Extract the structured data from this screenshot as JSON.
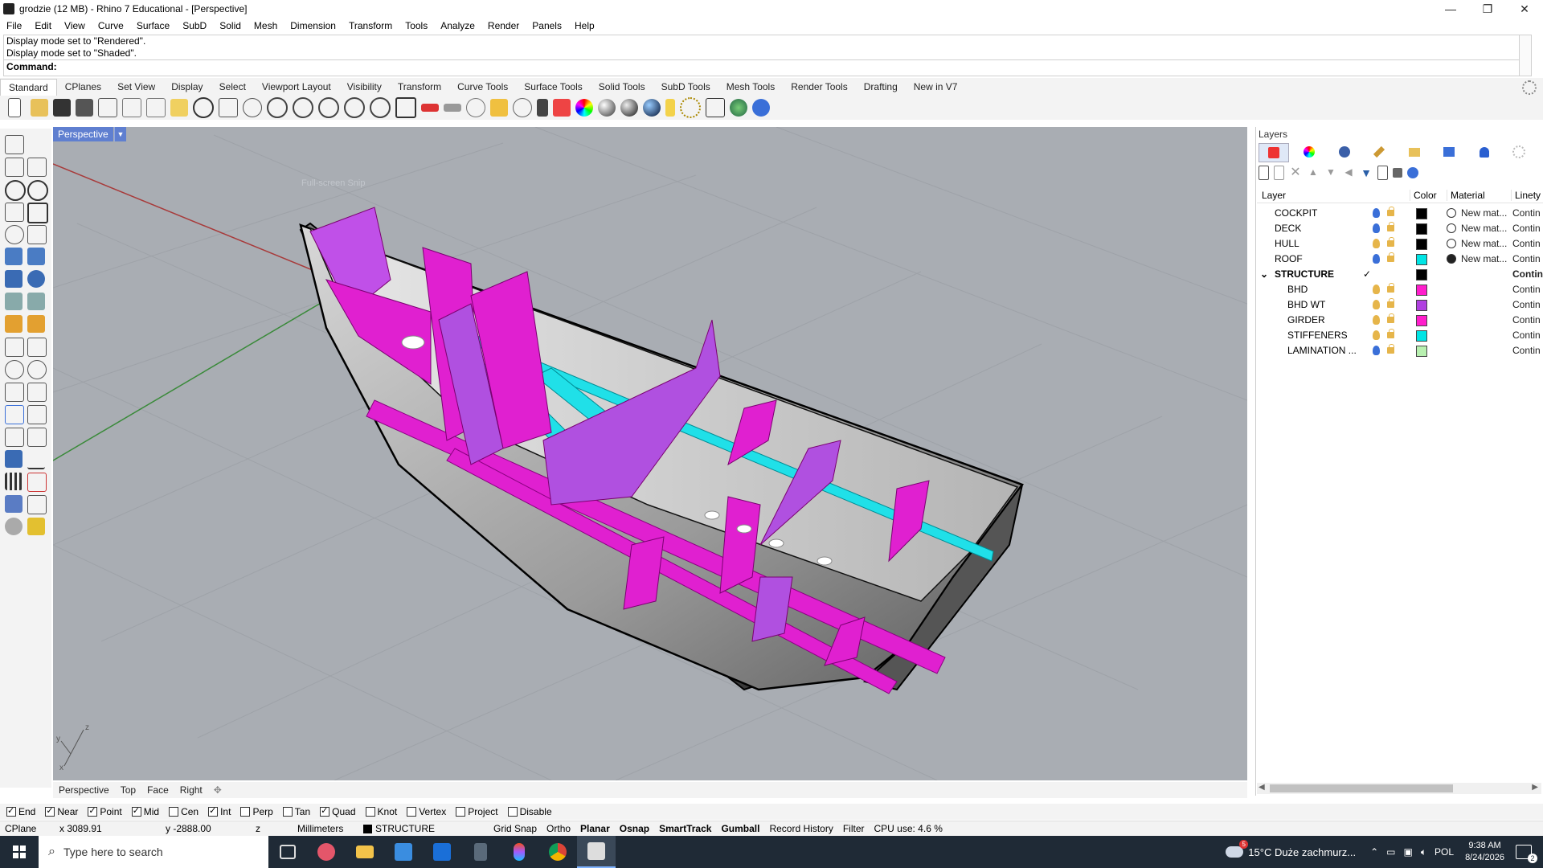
{
  "window": {
    "title": "grodzie (12 MB) - Rhino 7 Educational - [Perspective]",
    "minimize_glyph": "—",
    "restore_glyph": "❐",
    "close_glyph": "✕"
  },
  "menu": [
    "File",
    "Edit",
    "View",
    "Curve",
    "Surface",
    "SubD",
    "Solid",
    "Mesh",
    "Dimension",
    "Transform",
    "Tools",
    "Analyze",
    "Render",
    "Panels",
    "Help"
  ],
  "command_history": [
    "Display mode set to \"Rendered\".",
    "Display mode set to \"Shaded\"."
  ],
  "command_prompt": "Command:",
  "toolbar_tabs": [
    "Standard",
    "CPlanes",
    "Set View",
    "Display",
    "Select",
    "Viewport Layout",
    "Visibility",
    "Transform",
    "Curve Tools",
    "Surface Tools",
    "Solid Tools",
    "SubD Tools",
    "Mesh Tools",
    "Render Tools",
    "Drafting",
    "New in V7"
  ],
  "viewport": {
    "label": "Perspective",
    "watermark": "Full-screen Snip",
    "axis_z": "z",
    "axis_y": "y",
    "axis_x": "x"
  },
  "viewport_tabs": [
    "Perspective",
    "Top",
    "Face",
    "Right"
  ],
  "viewport_tab_add": "✥",
  "layers_panel": {
    "title": "Layers",
    "columns": {
      "layer": "Layer",
      "color": "Color",
      "material": "Material",
      "linetype": "Linety"
    },
    "rows": [
      {
        "name": "COCKPIT",
        "indent": 0,
        "color": "#000000",
        "material": "New mat...",
        "mat_fill": "#ffffff",
        "linetype": "Contin",
        "bulb": "#3a6fd8",
        "bold": false
      },
      {
        "name": "DECK",
        "indent": 0,
        "color": "#000000",
        "material": "New mat...",
        "mat_fill": "#ffffff",
        "linetype": "Contin",
        "bulb": "#3a6fd8",
        "bold": false
      },
      {
        "name": "HULL",
        "indent": 0,
        "color": "#000000",
        "material": "New mat...",
        "mat_fill": "#ffffff",
        "linetype": "Contin",
        "bulb": "#e6b54a",
        "bold": false
      },
      {
        "name": "ROOF",
        "indent": 0,
        "color": "#00e5e5",
        "material": "New mat...",
        "mat_fill": "#222222",
        "linetype": "Contin",
        "bulb": "#3a6fd8",
        "bold": false
      },
      {
        "name": "STRUCTURE",
        "indent": 0,
        "color": "#000000",
        "material": "",
        "mat_fill": "",
        "linetype": "Contin",
        "bulb": "",
        "bold": true,
        "current": "✓",
        "expand": "⌄"
      },
      {
        "name": "BHD",
        "indent": 1,
        "color": "#ff1ecc",
        "material": "",
        "mat_fill": "",
        "linetype": "Contin",
        "bulb": "#e6b54a",
        "bold": false
      },
      {
        "name": "BHD WT",
        "indent": 1,
        "color": "#b040e0",
        "material": "",
        "mat_fill": "",
        "linetype": "Contin",
        "bulb": "#e6b54a",
        "bold": false
      },
      {
        "name": "GIRDER",
        "indent": 1,
        "color": "#ff1ecc",
        "material": "",
        "mat_fill": "",
        "linetype": "Contin",
        "bulb": "#e6b54a",
        "bold": false
      },
      {
        "name": "STIFFENERS",
        "indent": 1,
        "color": "#00e5e5",
        "material": "",
        "mat_fill": "",
        "linetype": "Contin",
        "bulb": "#e6b54a",
        "bold": false
      },
      {
        "name": "LAMINATION ...",
        "indent": 1,
        "color": "#b8f0b0",
        "material": "",
        "mat_fill": "",
        "linetype": "Contin",
        "bulb": "#3a6fd8",
        "bold": false
      }
    ]
  },
  "osnaps": [
    {
      "label": "End",
      "on": true
    },
    {
      "label": "Near",
      "on": true
    },
    {
      "label": "Point",
      "on": true
    },
    {
      "label": "Mid",
      "on": true
    },
    {
      "label": "Cen",
      "on": false
    },
    {
      "label": "Int",
      "on": true
    },
    {
      "label": "Perp",
      "on": false
    },
    {
      "label": "Tan",
      "on": false
    },
    {
      "label": "Quad",
      "on": true
    },
    {
      "label": "Knot",
      "on": false
    },
    {
      "label": "Vertex",
      "on": false
    },
    {
      "label": "Project",
      "on": false
    },
    {
      "label": "Disable",
      "on": false
    }
  ],
  "status": {
    "cplane": "CPlane",
    "x": "x 3089.91",
    "y": "y -2888.00",
    "z": "z",
    "units": "Millimeters",
    "layer": "STRUCTURE",
    "grid_snap": "Grid Snap",
    "ortho": "Ortho",
    "planar": "Planar",
    "osnap": "Osnap",
    "smarttrack": "SmartTrack",
    "gumball": "Gumball",
    "record_history": "Record History",
    "filter": "Filter",
    "cpu": "CPU use: 4.6 %"
  },
  "taskbar": {
    "search_placeholder": "Type here to search",
    "weather": "15°C  Duże zachmurz...",
    "weather_badge": "5",
    "language": "POL",
    "time": "9:38 AM",
    "date": "8/24/2026",
    "notif_count": "2"
  },
  "colors": {
    "magenta": "#ff1ecc",
    "purple": "#b040e0",
    "cyan": "#00e5e5",
    "viewport_bg": "#a9adb3",
    "accent_blue": "#5f7fd0"
  }
}
